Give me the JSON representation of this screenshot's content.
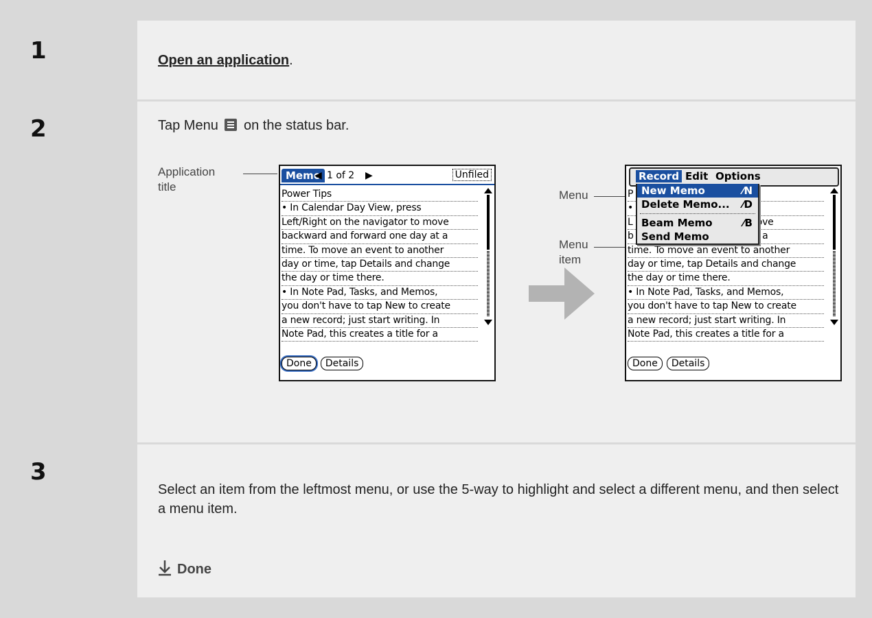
{
  "steps": [
    {
      "number": "1",
      "link_text": "Open an application",
      "suffix": "."
    },
    {
      "number": "2",
      "text_before": "Tap Menu",
      "text_after": "on the status bar."
    },
    {
      "number": "3",
      "text": "Select an item from the leftmost menu, or use the 5-way to highlight and select a different menu, and then select a menu item."
    }
  ],
  "callouts": {
    "application_title_1": "Application",
    "application_title_2": "title",
    "menu": "Menu",
    "menu_item_1": "Menu",
    "menu_item_2": "item"
  },
  "screen1": {
    "app_title": "Memo",
    "record_counter": "1 of 2",
    "category": "Unfiled",
    "lines": [
      "Power Tips",
      "• In Calendar Day View, press",
      "Left/Right on the navigator to move",
      "backward and forward one day at a",
      "time. To move an event to another",
      "day or time, tap Details and change",
      "the day or time there.",
      "• In Note Pad, Tasks, and Memos,",
      "you don't have to tap New to create",
      "a new record; just start writing. In",
      "Note Pad, this creates a title for a"
    ],
    "buttons": [
      "Done",
      "Details"
    ]
  },
  "screen2": {
    "menus": [
      "Record",
      "Edit",
      "Options"
    ],
    "menu_items": [
      {
        "label": "New Memo",
        "shortcut": "⁄N"
      },
      {
        "label": "Delete Memo...",
        "shortcut": "⁄D"
      },
      {
        "label": "Beam Memo",
        "shortcut": "⁄B"
      },
      {
        "label": "Send Memo",
        "shortcut": ""
      }
    ],
    "lines": [
      "P",
      "•                                   s",
      "L                                   to move",
      "b                                   ay at a",
      "time. To move an event to another",
      "day or time, tap Details and change",
      "the day or time there.",
      "• In Note Pad, Tasks, and Memos,",
      "you don't have to tap New to create",
      "a new record; just start writing. In",
      "Note Pad, this creates a title for a"
    ],
    "buttons": [
      "Done",
      "Details"
    ]
  },
  "done_label": "Done",
  "colors": {
    "accent": "#1a4fa0",
    "panel": "#efefef",
    "background": "#d9d9d9",
    "arrow": "#b3b3b3"
  },
  "icons": [
    "menu-icon",
    "arrow-right-icon",
    "down-arrow-icon"
  ]
}
